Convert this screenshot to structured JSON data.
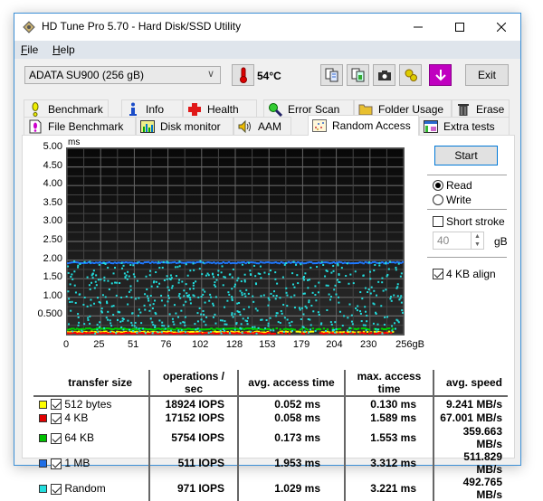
{
  "window": {
    "title": "HD Tune Pro 5.70 - Hard Disk/SSD Utility",
    "minimize": "—",
    "maximize": "☐",
    "close": "✕"
  },
  "menu": [
    "File",
    "Help"
  ],
  "toolbar": {
    "drive": "ADATA SU900 (256 gB)",
    "temperature": "54°C",
    "exit_label": "Exit",
    "icons": [
      "copy-text-icon",
      "copy-screenshot-icon",
      "camera-icon",
      "options-icon",
      "save-icon"
    ]
  },
  "tabs": {
    "row1": [
      {
        "label": "Benchmark",
        "icon": "benchmark-icon"
      },
      {
        "label": "Info",
        "icon": "info-icon"
      },
      {
        "label": "Health",
        "icon": "health-icon"
      },
      {
        "label": "Error Scan",
        "icon": "error-scan-icon"
      },
      {
        "label": "Folder Usage",
        "icon": "folder-icon"
      },
      {
        "label": "Erase",
        "icon": "trash-icon"
      }
    ],
    "row2": [
      {
        "label": "File Benchmark",
        "icon": "file-benchmark-icon"
      },
      {
        "label": "Disk monitor",
        "icon": "disk-monitor-icon"
      },
      {
        "label": "AAM",
        "icon": "speaker-icon"
      },
      {
        "label": "Random Access",
        "icon": "random-access-icon",
        "active": true
      },
      {
        "label": "Extra tests",
        "icon": "extra-tests-icon"
      }
    ]
  },
  "controls": {
    "start_label": "Start",
    "read_label": "Read",
    "write_label": "Write",
    "mode": "Read",
    "short_stroke_label": "Short stroke",
    "short_stroke_checked": false,
    "short_stroke_value": "40",
    "short_stroke_unit": "gB",
    "align_label": "4 KB align",
    "align_checked": true
  },
  "chart_data": {
    "type": "scatter",
    "ylabel": "ms",
    "xlabel": "gB",
    "ylim": [
      0,
      5.0
    ],
    "xlim": [
      0,
      256
    ],
    "y_ticks": [
      "5.00",
      "4.50",
      "4.00",
      "3.50",
      "3.00",
      "2.50",
      "2.00",
      "1.50",
      "1.00",
      "0.500"
    ],
    "x_ticks": [
      "0",
      "25",
      "51",
      "76",
      "102",
      "128",
      "153",
      "179",
      "204",
      "230",
      "256gB"
    ],
    "grid": true,
    "series": [
      {
        "name": "512 bytes",
        "color": "#ffff00",
        "level_ms": 0.052,
        "max_ms": 0.13
      },
      {
        "name": "4 KB",
        "color": "#ff0000",
        "level_ms": 0.058,
        "max_ms": 1.589
      },
      {
        "name": "64 KB",
        "color": "#00d000",
        "level_ms": 0.173,
        "max_ms": 1.553
      },
      {
        "name": "1 MB",
        "color": "#1e78ff",
        "level_ms": 1.953,
        "max_ms": 3.312
      },
      {
        "name": "Random",
        "color": "#22dddd",
        "level_ms": 1.029,
        "max_ms": 3.221,
        "spread": [
          0.05,
          2.0
        ]
      }
    ]
  },
  "results": {
    "headers": [
      "transfer size",
      "operations / sec",
      "avg. access time",
      "max. access time",
      "avg. speed"
    ],
    "rows": [
      {
        "size": "512 bytes",
        "color": "#ffff00",
        "checked": true,
        "ops": "18924 IOPS",
        "avg": "0.052 ms",
        "max": "0.130 ms",
        "speed": "9.241 MB/s"
      },
      {
        "size": "4 KB",
        "color": "#e00000",
        "checked": true,
        "ops": "17152 IOPS",
        "avg": "0.058 ms",
        "max": "1.589 ms",
        "speed": "67.001 MB/s"
      },
      {
        "size": "64 KB",
        "color": "#00c000",
        "checked": true,
        "ops": "5754 IOPS",
        "avg": "0.173 ms",
        "max": "1.553 ms",
        "speed": "359.663 MB/s"
      },
      {
        "size": "1 MB",
        "color": "#1e6ee6",
        "checked": true,
        "ops": "511 IOPS",
        "avg": "1.953 ms",
        "max": "3.312 ms",
        "speed": "511.829 MB/s"
      },
      {
        "size": "Random",
        "color": "#22dddd",
        "checked": true,
        "ops": "971 IOPS",
        "avg": "1.029 ms",
        "max": "3.221 ms",
        "speed": "492.765 MB/s"
      }
    ]
  }
}
